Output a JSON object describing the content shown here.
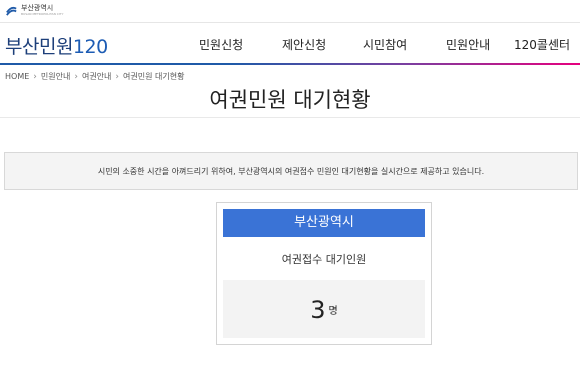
{
  "topbar": {
    "logo_text": "부산광역시",
    "logo_sub": "BUSAN METROPOLITAN CITY"
  },
  "header": {
    "brand": "부산민원",
    "brand_num": "120",
    "nav": [
      "민원신청",
      "제안신청",
      "시민참여",
      "민원안내",
      "120콜센터"
    ]
  },
  "breadcrumb": [
    "HOME",
    "민원안내",
    "여권안내",
    "여권민원 대기현황"
  ],
  "page": {
    "title": "여권민원 대기현황"
  },
  "notice": {
    "text": "시민의 소중한 시간을 아껴드리기 위하여, 부산광역시의 여권접수 민원인 대기현황을 실시간으로 제공하고 있습니다."
  },
  "card": {
    "header": "부산광역시",
    "label": "여권접수 대기인원",
    "count": "3",
    "unit": "명"
  },
  "colors": {
    "brand": "#1d3f7a",
    "accent": "#3a73d6",
    "bar_start": "#1f5aa8",
    "bar_end": "#e6007e"
  }
}
